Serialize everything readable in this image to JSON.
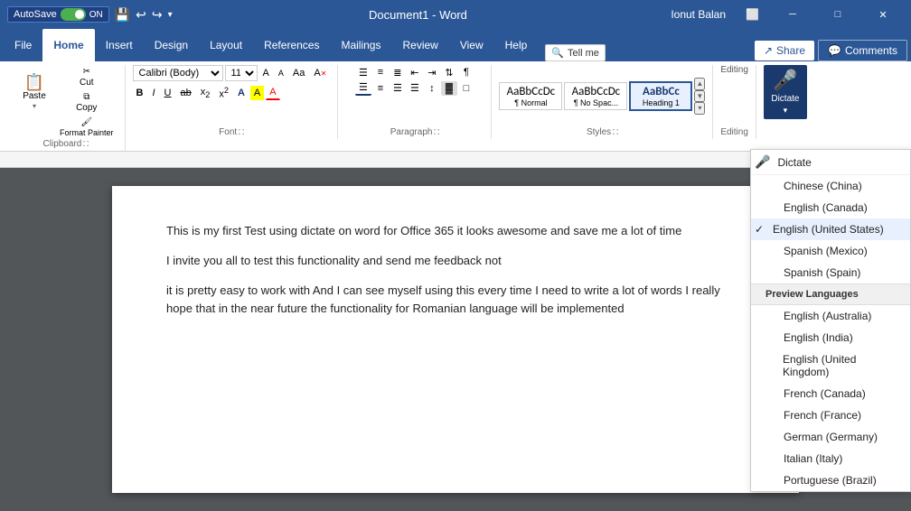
{
  "titleBar": {
    "autosave": "AutoSave",
    "autosave_state": "ON",
    "title": "Document1 - Word",
    "user": "Ionut Balan",
    "minimize": "─",
    "restore": "□",
    "close": "✕"
  },
  "ribbonTabs": {
    "tabs": [
      "File",
      "Home",
      "Insert",
      "Design",
      "Layout",
      "References",
      "Mailings",
      "Review",
      "View",
      "Help"
    ],
    "active": "Home",
    "tell_me": "Tell me",
    "share": "Share",
    "comments": "Comments"
  },
  "clipboard": {
    "label": "Clipboard",
    "paste": "Paste",
    "cut": "Cut",
    "copy": "Copy",
    "format_painter": "Format Painter"
  },
  "font": {
    "label": "Font",
    "font_name": "Calibri (Body)",
    "font_size": "11",
    "bold": "B",
    "italic": "I",
    "underline": "U",
    "strikethrough": "ab",
    "subscript": "x₂",
    "superscript": "x²",
    "grow": "A",
    "shrink": "A",
    "case": "Aa",
    "clear": "A",
    "highlight": "A",
    "font_color": "A"
  },
  "paragraph": {
    "label": "Paragraph",
    "bullets": "≡",
    "numbering": "≡",
    "multilevel": "≡",
    "decrease_indent": "⇐",
    "increase_indent": "⇒",
    "sort": "↕",
    "show_hide": "¶",
    "align_left": "≡",
    "align_center": "≡",
    "align_right": "≡",
    "justify": "≡",
    "line_spacing": "↕",
    "shading": "▓",
    "borders": "□"
  },
  "styles": {
    "label": "Styles",
    "items": [
      {
        "name": "Normal",
        "preview": "AaBbCcDc",
        "label": "¶ Normal",
        "selected": false
      },
      {
        "name": "No Spacing",
        "preview": "AaBbCcDc",
        "label": "¶ No Spac...",
        "selected": false
      },
      {
        "name": "Heading 1",
        "preview": "AaBbCc",
        "label": "Heading 1",
        "selected": false
      }
    ]
  },
  "editing": {
    "label": "Editing"
  },
  "dictate": {
    "label": "Dictate",
    "dropdown_arrow": "▾"
  },
  "document": {
    "lines": [
      "This is my first Test using dictate on word for Office 365 it looks awesome and save me a lot of time",
      "I invite you all to test this functionality and send me feedback not",
      "it is pretty easy to work with And I can see myself using this every time I need to write a lot of words I really hope that in the near future the functionality for Romanian language will be implemented"
    ]
  },
  "dropdown": {
    "dictate_label": "Dictate",
    "languages": [
      {
        "name": "Chinese (China)",
        "checked": false
      },
      {
        "name": "English (Canada)",
        "checked": false
      },
      {
        "name": "English (United States)",
        "checked": true
      },
      {
        "name": "Spanish (Mexico)",
        "checked": false
      },
      {
        "name": "Spanish (Spain)",
        "checked": false
      }
    ],
    "preview_header": "Preview Languages",
    "preview_languages": [
      {
        "name": "English (Australia)",
        "checked": false
      },
      {
        "name": "English (India)",
        "checked": false
      },
      {
        "name": "English (United Kingdom)",
        "checked": false
      },
      {
        "name": "French (Canada)",
        "checked": false
      },
      {
        "name": "French (France)",
        "checked": false
      },
      {
        "name": "German (Germany)",
        "checked": false
      },
      {
        "name": "Italian (Italy)",
        "checked": false
      },
      {
        "name": "Portuguese (Brazil)",
        "checked": false
      }
    ]
  },
  "colors": {
    "ribbon_bg": "#2b5797",
    "active_tab_bg": "#ffffff",
    "dictate_btn_bg": "#1a3a6e",
    "doc_bg": "#525659"
  }
}
